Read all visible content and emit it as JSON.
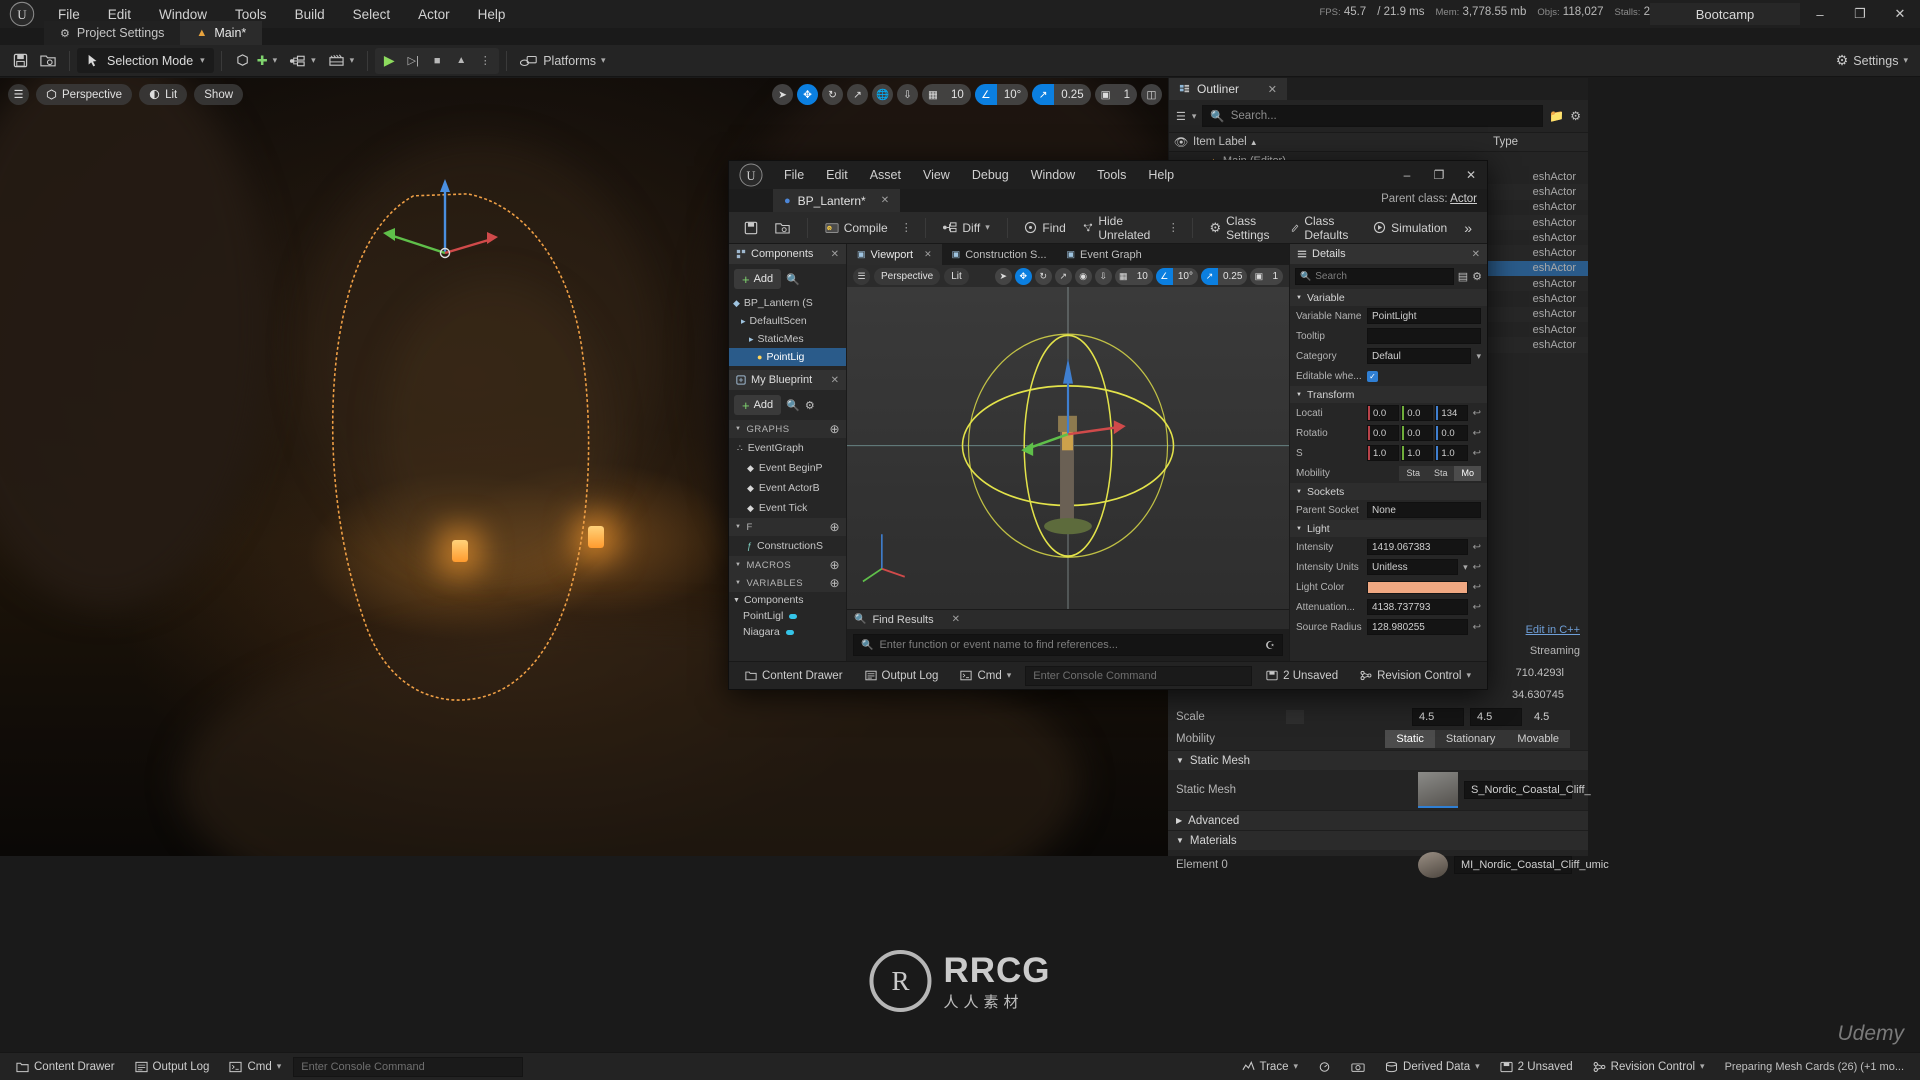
{
  "app": {
    "project_name": "Bootcamp",
    "menu": [
      "File",
      "Edit",
      "Window",
      "Tools",
      "Build",
      "Select",
      "Actor",
      "Help"
    ],
    "perf": {
      "fps_key": "FPS:",
      "fps_val": "45.7",
      "frame_ms": "/ 21.9 ms",
      "mem_key": "Mem:",
      "mem_val": "3,778.55 mb",
      "objs_key": "Objs:",
      "objs_val": "118,027",
      "stalls_key": "Stalls:",
      "stalls_val": "2"
    },
    "window_buttons": {
      "minimize": "–",
      "maximize": "❐",
      "close": "✕"
    }
  },
  "tabs": [
    {
      "label": "Project Settings",
      "icon": "settings-icon",
      "active": false
    },
    {
      "label": "Main*",
      "icon": "level-icon",
      "active": true
    }
  ],
  "toolbar": {
    "save_label": "",
    "mode_label": "Selection Mode",
    "platforms_label": "Platforms",
    "settings_label": "Settings",
    "play": "▶",
    "skip": "▷|",
    "stop": "■",
    "eject": "▲",
    "more": "⋮"
  },
  "viewport": {
    "view_mode": "Perspective",
    "lit_mode": "Lit",
    "show_label": "Show",
    "grid_snap": "10",
    "angle_snap": "10°",
    "scale_snap": "0.25",
    "camera_speed": "1"
  },
  "outliner": {
    "title": "Outliner",
    "search_placeholder": "Search...",
    "col_item": "Item Label",
    "col_type": "Type",
    "root": "Main (Editor)",
    "rows": [
      {
        "type": "eshActor"
      },
      {
        "type": "eshActor"
      },
      {
        "type": "eshActor"
      },
      {
        "type": "eshActor"
      },
      {
        "type": "eshActor"
      },
      {
        "type": "eshActor"
      },
      {
        "type": "eshActor",
        "selected": true
      },
      {
        "type": "eshActor"
      },
      {
        "type": "eshActor"
      },
      {
        "type": "eshActor"
      },
      {
        "type": "eshActor"
      },
      {
        "type": "eshActor"
      }
    ]
  },
  "details_main": {
    "scale_label": "Scale",
    "scale_vals": [
      "4.5",
      "4.5",
      "4.5"
    ],
    "mobility_label": "Mobility",
    "mobility_options": [
      "Static",
      "Stationary",
      "Movable"
    ],
    "mobility_selected": "Static",
    "static_mesh_section": "Static Mesh",
    "static_mesh_label": "Static Mesh",
    "static_mesh_value": "S_Nordic_Coastal_Cliff_",
    "advanced": "Advanced",
    "materials_section": "Materials",
    "element0_label": "Element 0",
    "element0_value": "MI_Nordic_Coastal_Cliff_umic",
    "edit_in_cpp": "Edit in C++",
    "streaming": "Streaming",
    "misc_values": [
      "710.4293l",
      "34.630745"
    ]
  },
  "blueprint": {
    "menu": [
      "File",
      "Edit",
      "Asset",
      "View",
      "Debug",
      "Window",
      "Tools",
      "Help"
    ],
    "tab_label": "BP_Lantern*",
    "parent_class_label": "Parent class:",
    "parent_class_value": "Actor",
    "toolbar": {
      "compile": "Compile",
      "diff": "Diff",
      "find": "Find",
      "hide_unrelated": "Hide Unrelated",
      "class_settings": "Class Settings",
      "class_defaults": "Class Defaults",
      "simulation": "Simulation",
      "overflow": "»"
    },
    "components_panel": {
      "title": "Components",
      "add_label": "Add",
      "tree": [
        {
          "label": "BP_Lantern (S",
          "indent": 0,
          "icon": "blueprint-icon"
        },
        {
          "label": "DefaultScen",
          "indent": 1,
          "icon": "scene-icon"
        },
        {
          "label": "StaticMes",
          "indent": 2,
          "icon": "mesh-icon"
        },
        {
          "label": "PointLig",
          "indent": 3,
          "icon": "light-icon",
          "selected": true
        }
      ]
    },
    "myblueprint_panel": {
      "title": "My Blueprint",
      "add_label": "Add",
      "sections": [
        {
          "name": "GRAPHS",
          "items": [
            {
              "label": "EventGraph",
              "icon": "graph-icon",
              "indent": 0
            },
            {
              "label": "Event BeginP",
              "icon": "event-icon",
              "indent": 1
            },
            {
              "label": "Event ActorB",
              "icon": "event-icon",
              "indent": 1
            },
            {
              "label": "Event Tick",
              "icon": "event-icon",
              "indent": 1
            }
          ]
        },
        {
          "name": "F",
          "items": [
            {
              "label": "ConstructionS",
              "icon": "function-icon",
              "indent": 1
            }
          ]
        },
        {
          "name": "MACROS",
          "items": []
        },
        {
          "name": "VARIABLES",
          "items": []
        }
      ],
      "components_group": "Components",
      "variables": [
        {
          "label": "PointLigl"
        },
        {
          "label": "Niagara"
        }
      ]
    },
    "center_tabs": [
      {
        "label": "Viewport",
        "active": true
      },
      {
        "label": "Construction S...",
        "active": false
      },
      {
        "label": "Event Graph",
        "active": false
      }
    ],
    "viewport": {
      "view_mode": "Perspective",
      "lit_mode": "Lit",
      "grid_snap": "10",
      "angle_snap": "10°",
      "scale_snap": "0.25",
      "camera_speed": "1"
    },
    "find_results": {
      "title": "Find Results",
      "placeholder": "Enter function or event name to find references..."
    },
    "details": {
      "title": "Details",
      "search_placeholder": "Search",
      "sections": [
        {
          "name": "Variable",
          "rows": [
            {
              "label": "Variable Name",
              "value": "PointLight",
              "kind": "text"
            },
            {
              "label": "Tooltip",
              "value": "",
              "kind": "text"
            },
            {
              "label": "Category",
              "value": "Defaul",
              "kind": "dropdown"
            },
            {
              "label": "Editable whe...",
              "value": "checked",
              "kind": "checkbox"
            }
          ]
        },
        {
          "name": "Transform",
          "rows": [
            {
              "label": "Locati",
              "kind": "vec3",
              "values": [
                "0.0",
                "0.0",
                "134"
              ]
            },
            {
              "label": "Rotatio",
              "kind": "vec3",
              "values": [
                "0.0",
                "0.0",
                "0.0"
              ]
            },
            {
              "label": "S",
              "kind": "vec3",
              "values": [
                "1.0",
                "1.0",
                "1.0"
              ]
            },
            {
              "label": "Mobility",
              "kind": "segments",
              "options": [
                "Sta",
                "Sta",
                "Mo"
              ],
              "selected": "Mo"
            }
          ]
        },
        {
          "name": "Sockets",
          "rows": [
            {
              "label": "Parent Socket",
              "value": "None",
              "kind": "text"
            }
          ]
        },
        {
          "name": "Light",
          "rows": [
            {
              "label": "Intensity",
              "value": "1419.067383",
              "kind": "text"
            },
            {
              "label": "Intensity Units",
              "value": "Unitless",
              "kind": "dropdown"
            },
            {
              "label": "Light Color",
              "value": "#f0a882",
              "kind": "color"
            },
            {
              "label": "Attenuation...",
              "value": "4138.737793",
              "kind": "text"
            },
            {
              "label": "Source Radius",
              "value": "128.980255",
              "kind": "text"
            }
          ]
        }
      ]
    },
    "status": {
      "content_drawer": "Content Drawer",
      "output_log": "Output Log",
      "cmd": "Cmd",
      "cmd_placeholder": "Enter Console Command",
      "unsaved": "2 Unsaved",
      "revision": "Revision Control"
    }
  },
  "statusbar": {
    "content_drawer": "Content Drawer",
    "output_log": "Output Log",
    "cmd": "Cmd",
    "cmd_placeholder": "Enter Console Command",
    "trace": "Trace",
    "derived_data": "Derived Data",
    "unsaved": "2 Unsaved",
    "revision": "Revision Control",
    "progress": "Preparing Mesh Cards (26) (+1 mo..."
  },
  "watermark": {
    "ring": "R",
    "title": "RRCG",
    "subtitle": "人人素材",
    "udemy": "Udemy"
  }
}
